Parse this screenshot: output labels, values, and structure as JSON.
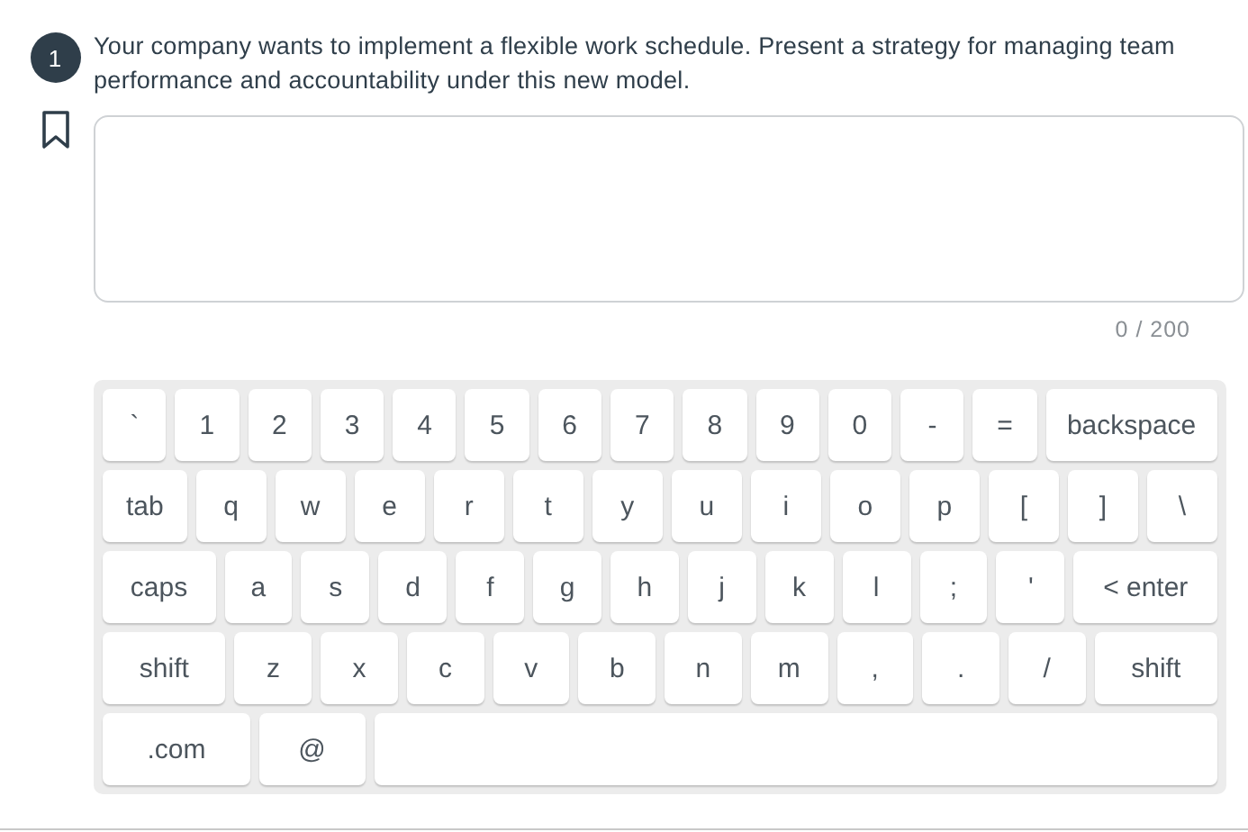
{
  "question": {
    "number": "1",
    "text": "Your company wants to implement a flexible work schedule. Present a strategy for managing team performance and accountability under this new model.",
    "bookmarked": false
  },
  "answer": {
    "counter": "0 / 200"
  },
  "keyboard": {
    "rows": [
      [
        {
          "label": "`",
          "kind": "key"
        },
        {
          "label": "1",
          "kind": "key"
        },
        {
          "label": "2",
          "kind": "key"
        },
        {
          "label": "3",
          "kind": "key"
        },
        {
          "label": "4",
          "kind": "key"
        },
        {
          "label": "5",
          "kind": "key"
        },
        {
          "label": "6",
          "kind": "key"
        },
        {
          "label": "7",
          "kind": "key"
        },
        {
          "label": "8",
          "kind": "key"
        },
        {
          "label": "9",
          "kind": "key"
        },
        {
          "label": "0",
          "kind": "key"
        },
        {
          "label": "-",
          "kind": "key"
        },
        {
          "label": "=",
          "kind": "key"
        },
        {
          "label": "backspace",
          "kind": "backspace"
        }
      ],
      [
        {
          "label": "tab",
          "kind": "tab"
        },
        {
          "label": "q",
          "kind": "key"
        },
        {
          "label": "w",
          "kind": "key"
        },
        {
          "label": "e",
          "kind": "key"
        },
        {
          "label": "r",
          "kind": "key"
        },
        {
          "label": "t",
          "kind": "key"
        },
        {
          "label": "y",
          "kind": "key"
        },
        {
          "label": "u",
          "kind": "key"
        },
        {
          "label": "i",
          "kind": "key"
        },
        {
          "label": "o",
          "kind": "key"
        },
        {
          "label": "p",
          "kind": "key"
        },
        {
          "label": "[",
          "kind": "key"
        },
        {
          "label": "]",
          "kind": "key"
        },
        {
          "label": "\\",
          "kind": "key"
        }
      ],
      [
        {
          "label": "caps",
          "kind": "caps"
        },
        {
          "label": "a",
          "kind": "key"
        },
        {
          "label": "s",
          "kind": "key"
        },
        {
          "label": "d",
          "kind": "key"
        },
        {
          "label": "f",
          "kind": "key"
        },
        {
          "label": "g",
          "kind": "key"
        },
        {
          "label": "h",
          "kind": "key"
        },
        {
          "label": "j",
          "kind": "key"
        },
        {
          "label": "k",
          "kind": "key"
        },
        {
          "label": "l",
          "kind": "key"
        },
        {
          "label": ";",
          "kind": "key"
        },
        {
          "label": "'",
          "kind": "key"
        },
        {
          "label": "< enter",
          "kind": "enter"
        }
      ],
      [
        {
          "label": "shift",
          "kind": "shift"
        },
        {
          "label": "z",
          "kind": "key"
        },
        {
          "label": "x",
          "kind": "key"
        },
        {
          "label": "c",
          "kind": "key"
        },
        {
          "label": "v",
          "kind": "key"
        },
        {
          "label": "b",
          "kind": "key"
        },
        {
          "label": "n",
          "kind": "key"
        },
        {
          "label": "m",
          "kind": "key"
        },
        {
          "label": ",",
          "kind": "key"
        },
        {
          "label": ".",
          "kind": "key"
        },
        {
          "label": "/",
          "kind": "key"
        },
        {
          "label": "shift",
          "kind": "shift"
        }
      ],
      [
        {
          "label": ".com",
          "kind": "com"
        },
        {
          "label": "@",
          "kind": "at"
        },
        {
          "kind": "space"
        }
      ]
    ]
  }
}
